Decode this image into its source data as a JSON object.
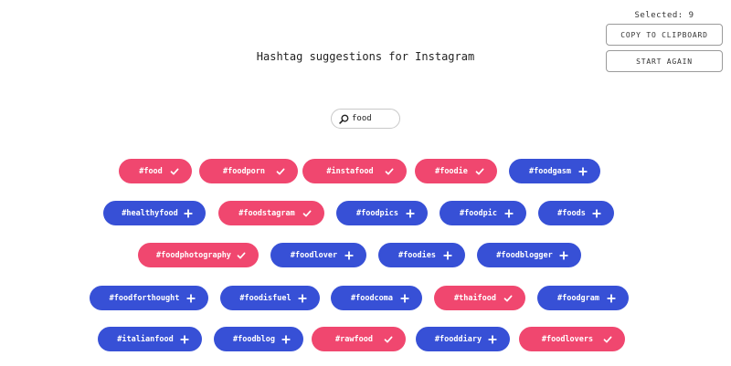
{
  "header": {
    "selected_text": "Selected: 9",
    "copy_label": "COPY TO CLIPBOARD",
    "start_label": "START AGAIN"
  },
  "title": "Hashtag suggestions for Instagram",
  "search": {
    "value": "food",
    "icon": "search-icon"
  },
  "colors": {
    "selected": "#f0476f",
    "unselected": "#3750d6"
  },
  "tags": [
    {
      "label": "#food",
      "selected": true
    },
    {
      "label": "#foodporn",
      "selected": true
    },
    {
      "label": "#instafood",
      "selected": true
    },
    {
      "label": "#foodie",
      "selected": true
    },
    {
      "label": "#foodgasm",
      "selected": false
    },
    {
      "label": "#healthyfood",
      "selected": false
    },
    {
      "label": "#foodstagram",
      "selected": true
    },
    {
      "label": "#foodpics",
      "selected": false
    },
    {
      "label": "#foodpic",
      "selected": false
    },
    {
      "label": "#foods",
      "selected": false
    },
    {
      "label": "#foodphotography",
      "selected": true
    },
    {
      "label": "#foodlover",
      "selected": false
    },
    {
      "label": "#foodies",
      "selected": false
    },
    {
      "label": "#foodblogger",
      "selected": false
    },
    {
      "label": "#foodforthought",
      "selected": false
    },
    {
      "label": "#foodisfuel",
      "selected": false
    },
    {
      "label": "#foodcoma",
      "selected": false
    },
    {
      "label": "#thaifood",
      "selected": true
    },
    {
      "label": "#foodgram",
      "selected": false
    },
    {
      "label": "#italianfood",
      "selected": false
    },
    {
      "label": "#foodblog",
      "selected": false
    },
    {
      "label": "#rawfood",
      "selected": true
    },
    {
      "label": "#fooddiary",
      "selected": false
    },
    {
      "label": "#foodlovers",
      "selected": true
    }
  ]
}
